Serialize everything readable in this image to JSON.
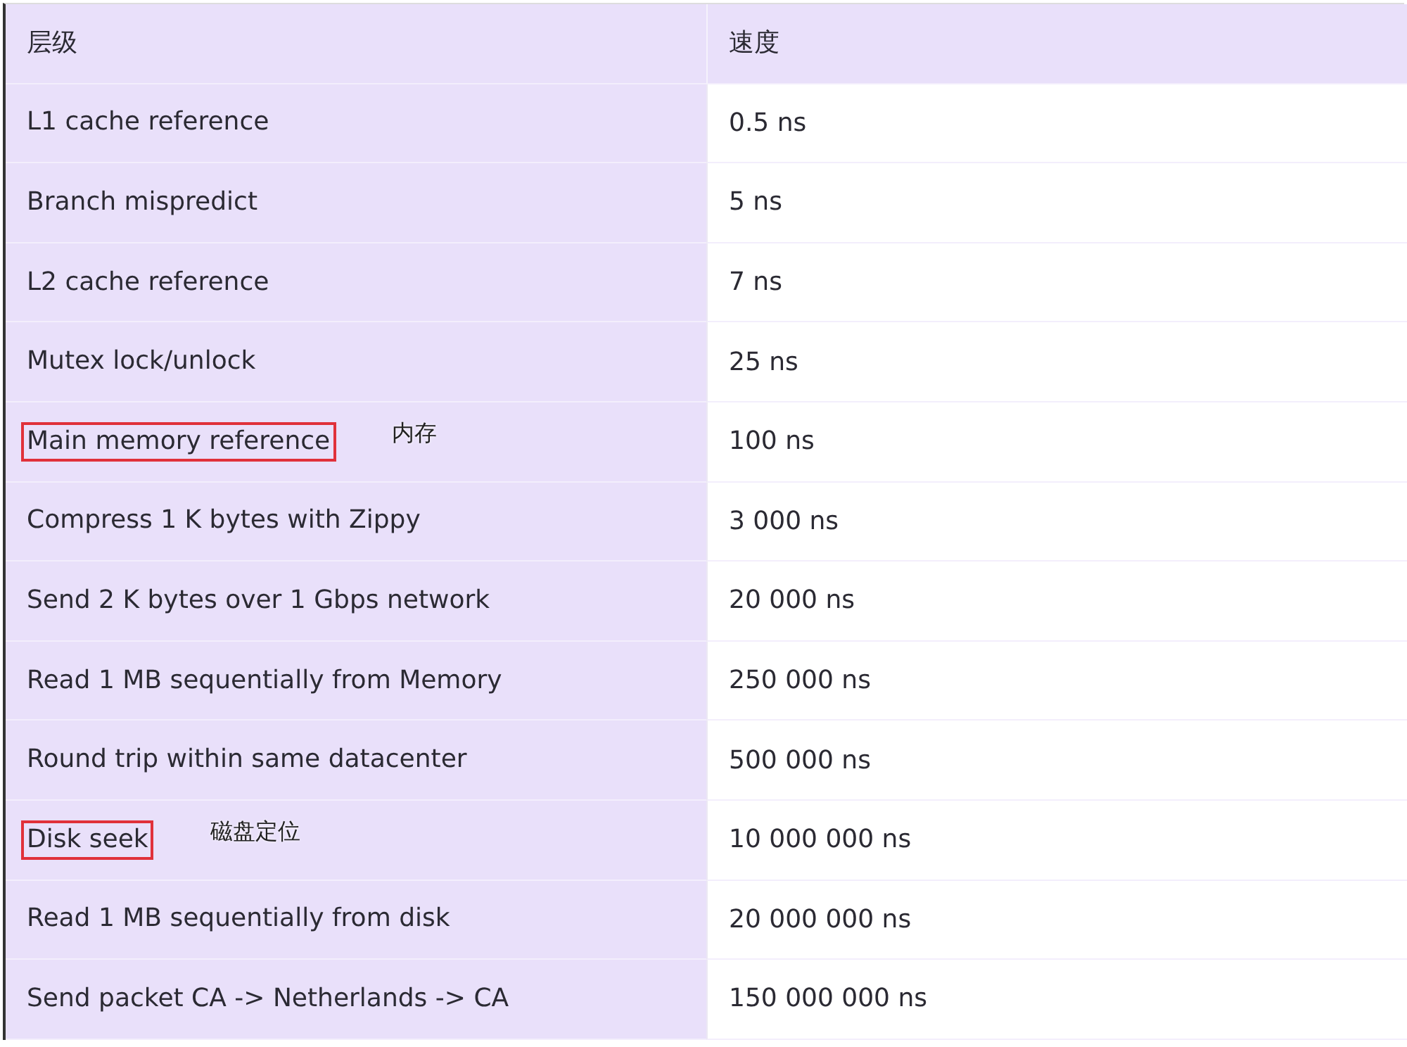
{
  "table": {
    "columns": [
      "层级",
      "速度"
    ],
    "rows": [
      {
        "level": "L1 cache reference",
        "speed": "0.5 ns",
        "highlighted": false
      },
      {
        "level": "Branch mispredict",
        "speed": "5 ns",
        "highlighted": false
      },
      {
        "level": "L2 cache reference",
        "speed": "7 ns",
        "highlighted": false
      },
      {
        "level": "Mutex lock/unlock",
        "speed": "25 ns",
        "highlighted": false
      },
      {
        "level": "Main memory reference",
        "speed": "100 ns",
        "highlighted": true,
        "note": "内存"
      },
      {
        "level": "Compress 1 K bytes with Zippy",
        "speed": "3 000 ns",
        "highlighted": false
      },
      {
        "level": "Send 2 K bytes over 1 Gbps network",
        "speed": "20 000 ns",
        "highlighted": false
      },
      {
        "level": "Read 1 MB sequentially from Memory",
        "speed": "250 000 ns",
        "highlighted": false
      },
      {
        "level": "Round trip within same datacenter",
        "speed": "500 000 ns",
        "highlighted": false
      },
      {
        "level": "Disk seek",
        "speed": "10 000 000 ns",
        "highlighted": true,
        "note": "磁盘定位"
      },
      {
        "level": "Read 1 MB sequentially from disk",
        "speed": "20 000 000 ns",
        "highlighted": false
      },
      {
        "level": "Send packet CA -> Netherlands -> CA",
        "speed": "150 000 000 ns",
        "highlighted": false
      }
    ]
  }
}
